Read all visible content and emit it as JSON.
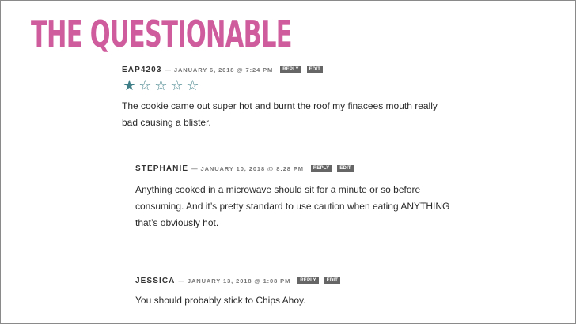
{
  "site": {
    "title": "THE QUESTIONABLE",
    "brand_color": "#cf5c9c"
  },
  "comments": [
    {
      "author": "EAP4203",
      "date": "— JANUARY 6, 2018 @ 7:24 PM",
      "reply_label": "REPLY",
      "edit_label": "EDIT",
      "rating": 1,
      "rating_max": 5,
      "star_filled": "★",
      "star_empty": "☆",
      "star_color": "#3e7f87",
      "text": "The cookie came out super hot and burnt the roof my finacees mouth really bad causing a blister."
    },
    {
      "author": "STEPHANIE",
      "date": "— JANUARY 10, 2018 @ 8:28 PM",
      "reply_label": "REPLY",
      "edit_label": "EDIT",
      "text": "Anything cooked in a microwave should sit for a minute or so before consuming. And it’s pretty standard to use caution when eating ANYTHING that’s obviously hot."
    },
    {
      "author": "JESSICA",
      "date": "— JANUARY 13, 2018 @ 1:08 PM",
      "reply_label": "REPLY",
      "edit_label": "EDIT",
      "text": "You should probably stick to Chips Ahoy."
    }
  ]
}
